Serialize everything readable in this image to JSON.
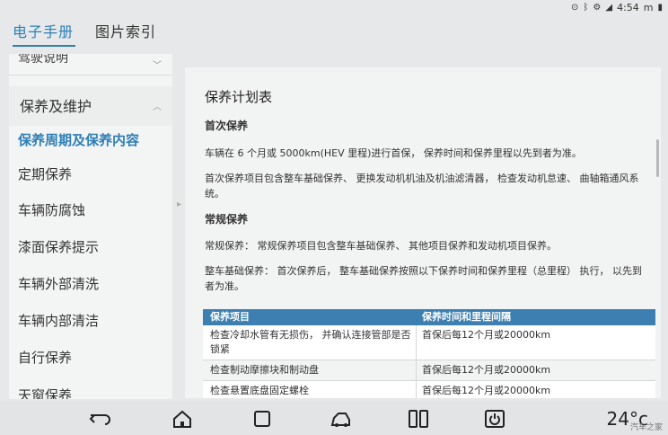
{
  "status": {
    "time": "4:54",
    "battery_label": "m"
  },
  "tabs": [
    {
      "label": "电子手册",
      "active": true
    },
    {
      "label": "图片索引",
      "active": false
    }
  ],
  "sidebar": {
    "collapsed_section": "驾驶说明",
    "section_title": "保养及维护",
    "items": [
      {
        "label": "保养周期及保养内容",
        "active": true
      },
      {
        "label": "定期保养"
      },
      {
        "label": "车辆防腐蚀"
      },
      {
        "label": "漆面保养提示"
      },
      {
        "label": "车辆外部清洗"
      },
      {
        "label": "车辆内部清洁"
      },
      {
        "label": "自行保养"
      },
      {
        "label": "天窗保养"
      }
    ]
  },
  "content": {
    "title": "保养计划表",
    "first": {
      "heading": "首次保养",
      "p1": "车辆在 6 个月或 5000km(HEV 里程)进行首保， 保养时间和保养里程以先到者为准。",
      "p2": "首次保养项目包含整车基础保养、 更换发动机机油及机油滤清器， 检查发动机怠速、 曲轴箱通风系统。"
    },
    "regular": {
      "heading": "常规保养",
      "p1": "常规保养： 常规保养项目包含整车基础保养、 其他项目保养和发动机项目保养。",
      "p2": "整车基础保养： 首次保养后， 整车基础保养按照以下保养时间和保养里程（总里程） 执行， 以先到者为准。"
    },
    "table": {
      "headers": [
        "保养项目",
        "保养时间和里程间隔"
      ],
      "rows": [
        [
          "检查冷却水管有无损伤， 并确认连接管部是否锁紧",
          "首保后每12个月或20000km"
        ],
        [
          "检查制动摩擦块和制动盘",
          "首保后每12个月或20000km"
        ],
        [
          "检查悬置底盘固定螺栓",
          "首保后每12个月或20000km"
        ]
      ]
    }
  },
  "navbar": {
    "temperature": "24°c",
    "watermark": "汽车之家"
  },
  "colors": {
    "accent": "#2e7fb6",
    "table_header": "#3c7fb0"
  }
}
